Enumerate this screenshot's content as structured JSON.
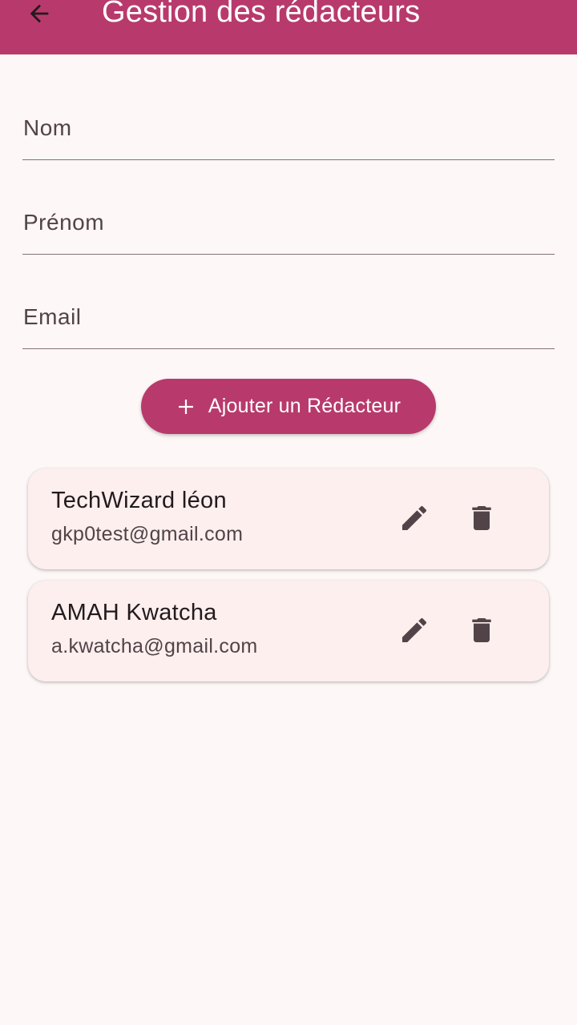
{
  "header": {
    "title": "Gestion des rédacteurs",
    "back_icon": "arrow-back-icon",
    "background": "#b83a6c"
  },
  "form": {
    "nom_placeholder": "Nom",
    "prenom_placeholder": "Prénom",
    "email_placeholder": "Email",
    "nom_value": "",
    "prenom_value": "",
    "email_value": ""
  },
  "add_button": {
    "label": "Ajouter un Rédacteur",
    "icon": "plus-icon"
  },
  "writers": [
    {
      "name": "TechWizard léon",
      "email": "gkp0test@gmail.com"
    },
    {
      "name": "AMAH Kwatcha",
      "email": "a.kwatcha@gmail.com"
    }
  ],
  "colors": {
    "accent": "#b83a6c",
    "background": "#fdf7f7",
    "card": "#fcefee",
    "icon": "#514347"
  }
}
